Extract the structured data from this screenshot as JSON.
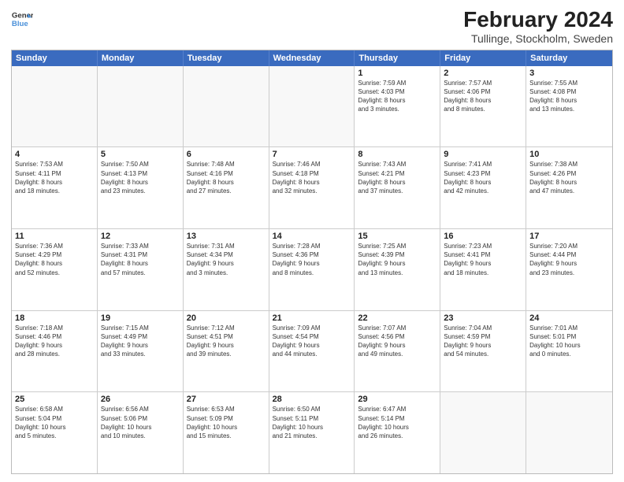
{
  "header": {
    "logo_line1": "General",
    "logo_line2": "Blue",
    "month_year": "February 2024",
    "location": "Tullinge, Stockholm, Sweden"
  },
  "days_of_week": [
    "Sunday",
    "Monday",
    "Tuesday",
    "Wednesday",
    "Thursday",
    "Friday",
    "Saturday"
  ],
  "weeks": [
    [
      {
        "day": "",
        "info": ""
      },
      {
        "day": "",
        "info": ""
      },
      {
        "day": "",
        "info": ""
      },
      {
        "day": "",
        "info": ""
      },
      {
        "day": "1",
        "info": "Sunrise: 7:59 AM\nSunset: 4:03 PM\nDaylight: 8 hours\nand 3 minutes."
      },
      {
        "day": "2",
        "info": "Sunrise: 7:57 AM\nSunset: 4:06 PM\nDaylight: 8 hours\nand 8 minutes."
      },
      {
        "day": "3",
        "info": "Sunrise: 7:55 AM\nSunset: 4:08 PM\nDaylight: 8 hours\nand 13 minutes."
      }
    ],
    [
      {
        "day": "4",
        "info": "Sunrise: 7:53 AM\nSunset: 4:11 PM\nDaylight: 8 hours\nand 18 minutes."
      },
      {
        "day": "5",
        "info": "Sunrise: 7:50 AM\nSunset: 4:13 PM\nDaylight: 8 hours\nand 23 minutes."
      },
      {
        "day": "6",
        "info": "Sunrise: 7:48 AM\nSunset: 4:16 PM\nDaylight: 8 hours\nand 27 minutes."
      },
      {
        "day": "7",
        "info": "Sunrise: 7:46 AM\nSunset: 4:18 PM\nDaylight: 8 hours\nand 32 minutes."
      },
      {
        "day": "8",
        "info": "Sunrise: 7:43 AM\nSunset: 4:21 PM\nDaylight: 8 hours\nand 37 minutes."
      },
      {
        "day": "9",
        "info": "Sunrise: 7:41 AM\nSunset: 4:23 PM\nDaylight: 8 hours\nand 42 minutes."
      },
      {
        "day": "10",
        "info": "Sunrise: 7:38 AM\nSunset: 4:26 PM\nDaylight: 8 hours\nand 47 minutes."
      }
    ],
    [
      {
        "day": "11",
        "info": "Sunrise: 7:36 AM\nSunset: 4:29 PM\nDaylight: 8 hours\nand 52 minutes."
      },
      {
        "day": "12",
        "info": "Sunrise: 7:33 AM\nSunset: 4:31 PM\nDaylight: 8 hours\nand 57 minutes."
      },
      {
        "day": "13",
        "info": "Sunrise: 7:31 AM\nSunset: 4:34 PM\nDaylight: 9 hours\nand 3 minutes."
      },
      {
        "day": "14",
        "info": "Sunrise: 7:28 AM\nSunset: 4:36 PM\nDaylight: 9 hours\nand 8 minutes."
      },
      {
        "day": "15",
        "info": "Sunrise: 7:25 AM\nSunset: 4:39 PM\nDaylight: 9 hours\nand 13 minutes."
      },
      {
        "day": "16",
        "info": "Sunrise: 7:23 AM\nSunset: 4:41 PM\nDaylight: 9 hours\nand 18 minutes."
      },
      {
        "day": "17",
        "info": "Sunrise: 7:20 AM\nSunset: 4:44 PM\nDaylight: 9 hours\nand 23 minutes."
      }
    ],
    [
      {
        "day": "18",
        "info": "Sunrise: 7:18 AM\nSunset: 4:46 PM\nDaylight: 9 hours\nand 28 minutes."
      },
      {
        "day": "19",
        "info": "Sunrise: 7:15 AM\nSunset: 4:49 PM\nDaylight: 9 hours\nand 33 minutes."
      },
      {
        "day": "20",
        "info": "Sunrise: 7:12 AM\nSunset: 4:51 PM\nDaylight: 9 hours\nand 39 minutes."
      },
      {
        "day": "21",
        "info": "Sunrise: 7:09 AM\nSunset: 4:54 PM\nDaylight: 9 hours\nand 44 minutes."
      },
      {
        "day": "22",
        "info": "Sunrise: 7:07 AM\nSunset: 4:56 PM\nDaylight: 9 hours\nand 49 minutes."
      },
      {
        "day": "23",
        "info": "Sunrise: 7:04 AM\nSunset: 4:59 PM\nDaylight: 9 hours\nand 54 minutes."
      },
      {
        "day": "24",
        "info": "Sunrise: 7:01 AM\nSunset: 5:01 PM\nDaylight: 10 hours\nand 0 minutes."
      }
    ],
    [
      {
        "day": "25",
        "info": "Sunrise: 6:58 AM\nSunset: 5:04 PM\nDaylight: 10 hours\nand 5 minutes."
      },
      {
        "day": "26",
        "info": "Sunrise: 6:56 AM\nSunset: 5:06 PM\nDaylight: 10 hours\nand 10 minutes."
      },
      {
        "day": "27",
        "info": "Sunrise: 6:53 AM\nSunset: 5:09 PM\nDaylight: 10 hours\nand 15 minutes."
      },
      {
        "day": "28",
        "info": "Sunrise: 6:50 AM\nSunset: 5:11 PM\nDaylight: 10 hours\nand 21 minutes."
      },
      {
        "day": "29",
        "info": "Sunrise: 6:47 AM\nSunset: 5:14 PM\nDaylight: 10 hours\nand 26 minutes."
      },
      {
        "day": "",
        "info": ""
      },
      {
        "day": "",
        "info": ""
      }
    ]
  ]
}
